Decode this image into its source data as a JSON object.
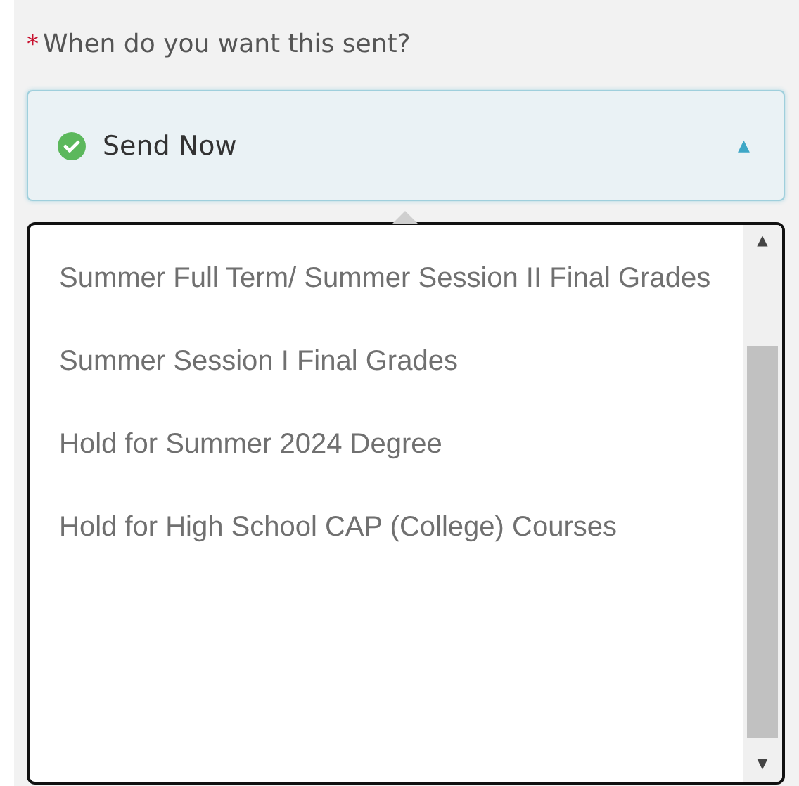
{
  "field": {
    "required_mark": "*",
    "label": "When do you want this sent?",
    "value": "Send Now",
    "caret": "▲"
  },
  "dropdown": {
    "options": [
      {
        "label": "Summer Full Term/ Summer Session II Final Grades"
      },
      {
        "label": "Summer Session I Final Grades"
      },
      {
        "label": "Hold for Summer 2024 Degree"
      },
      {
        "label": "Hold for High School CAP (College) Courses"
      }
    ],
    "scroll_up": "▲",
    "scroll_down": "▼"
  }
}
